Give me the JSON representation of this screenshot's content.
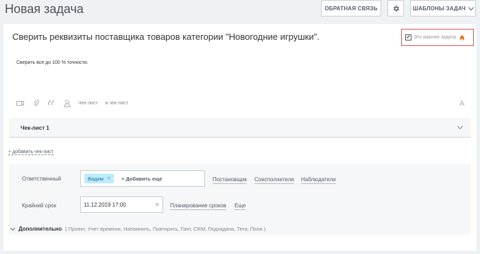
{
  "header": {
    "title": "Новая задача",
    "feedback_label": "ОБРАТНАЯ СВЯЗЬ",
    "templates_label": "ШАБЛОНЫ ЗАДАЧ"
  },
  "task": {
    "title": "Сверить реквизиты поставщика товаров категории \"Новогодние игрушки\".",
    "important_label": "Это важная задача",
    "important_checked": true,
    "description": "Сверить все до 100 % точности."
  },
  "editor_toolbar": {
    "checklist_label": "Чек-лист",
    "in_checklist_label": "в чек-лист",
    "font_label": "A"
  },
  "checklist": {
    "name": "Чек-лист 1",
    "add_label": "+ добавить чек-лист"
  },
  "fields": {
    "responsible_label": "Ответственный",
    "responsible_user": "Вадим",
    "add_more_label": "+ Добавить еще",
    "role_links": [
      "Постановщик",
      "Соисполнители",
      "Наблюдатели"
    ],
    "deadline_label": "Крайний срок",
    "deadline_value": "11.12.2019 17:00",
    "deadline_links": [
      "Планирование сроков",
      "Еще"
    ]
  },
  "additional": {
    "label": "Дополнительно",
    "options": "( Проект,  Учет времени,  Напомнить,  Повторять,  Гант,  CRM,  Подзадача,  Теги,  Поля )"
  },
  "colors": {
    "accent_red": "#d9534f",
    "chip_bg": "#bcedfc",
    "page_bg": "#eef2f4"
  }
}
